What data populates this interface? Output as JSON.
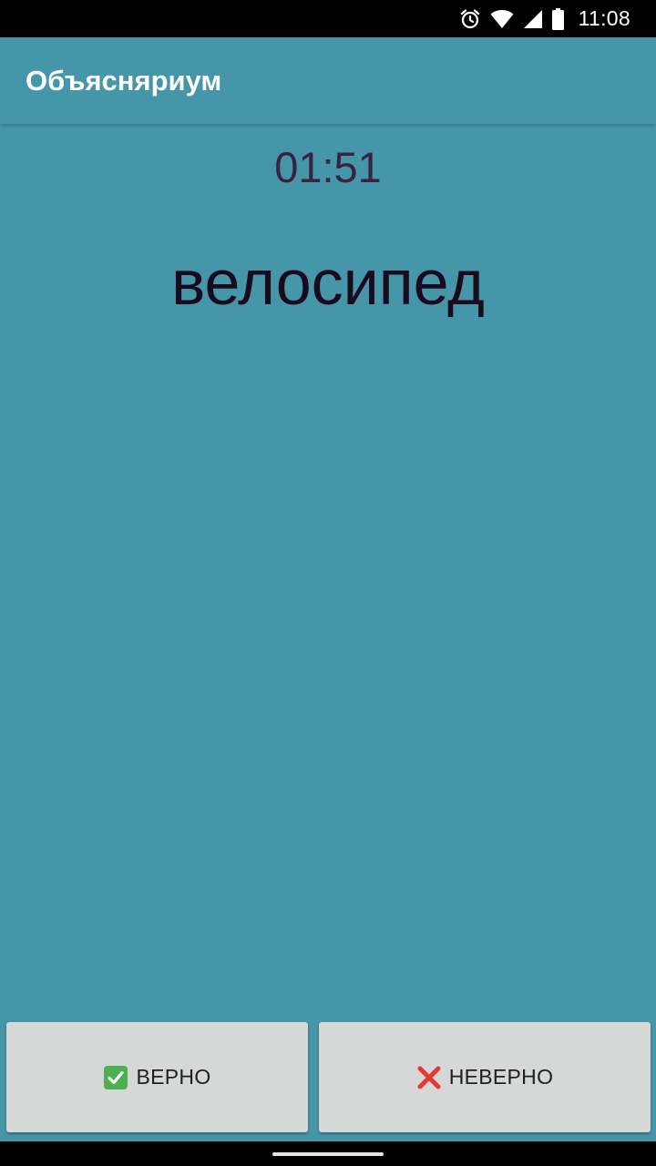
{
  "status_bar": {
    "time": "11:08",
    "icons": [
      "alarm-icon",
      "wifi-icon",
      "cell-signal-icon",
      "battery-icon"
    ]
  },
  "app_bar": {
    "title": "Объясняриум"
  },
  "game": {
    "timer": "01:51",
    "word": "велосипед"
  },
  "buttons": {
    "correct": {
      "label": "ВЕРНО",
      "icon": "check-mark-icon"
    },
    "wrong": {
      "label": "НЕВЕРНО",
      "icon": "cross-mark-icon"
    }
  },
  "colors": {
    "background": "#4596a8",
    "button": "#d6d7d7",
    "timer_text": "#3b2340",
    "word_text": "#1a0a1e",
    "correct_icon": "#4caf50",
    "wrong_icon": "#e53935"
  }
}
